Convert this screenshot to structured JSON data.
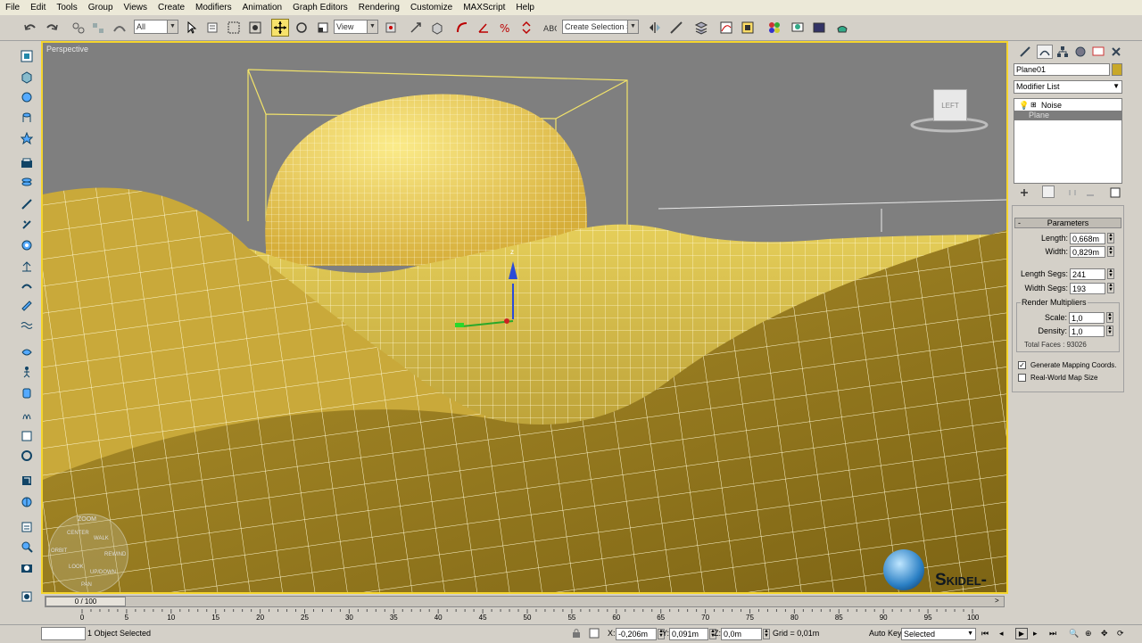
{
  "menu": [
    "File",
    "Edit",
    "Tools",
    "Group",
    "Views",
    "Create",
    "Modifiers",
    "Animation",
    "Graph Editors",
    "Rendering",
    "Customize",
    "MAXScript",
    "Help"
  ],
  "toolbar": {
    "selection_filter": "All",
    "ref_coord": "View",
    "named_selection": "Create Selection Se"
  },
  "viewport": {
    "label": "Perspective",
    "viewcube_label": "LEFT",
    "steering_wheel": [
      "ZOOM",
      "ORBIT",
      "CENTER",
      "WALK",
      "REWIND",
      "LOOK",
      "UP/DOWN",
      "PAN"
    ],
    "watermark": "Skidel-sky.ru",
    "gizmo_axis_z": "z",
    "colors": {
      "background": "#7f7f7f",
      "mesh_fill": "#c9a93a",
      "wire": "#ffffe0",
      "border": "#f5d52d"
    }
  },
  "command_panel": {
    "object_name": "Plane01",
    "object_color": "#c8a828",
    "modifier_list_label": "Modifier List",
    "stack": [
      "Noise",
      "Plane"
    ],
    "rollout_title": "Parameters",
    "params": {
      "length_label": "Length:",
      "length_value": "0,668m",
      "width_label": "Width:",
      "width_value": "0,829m",
      "length_segs_label": "Length Segs:",
      "length_segs_value": "241",
      "width_segs_label": "Width Segs:",
      "width_segs_value": "193",
      "render_multipliers_label": "Render Multipliers",
      "scale_label": "Scale:",
      "scale_value": "1,0",
      "density_label": "Density:",
      "density_value": "1,0",
      "total_faces_label": "Total Faces : 93026",
      "gen_mapping_label": "Generate Mapping Coords.",
      "gen_mapping_checked": true,
      "real_world_label": "Real-World Map Size",
      "real_world_checked": false
    }
  },
  "timeline": {
    "frame_label": "0 / 100",
    "ticks": [
      "0",
      "5",
      "10",
      "15",
      "20",
      "25",
      "30",
      "35",
      "40",
      "45",
      "50",
      "55",
      "60",
      "65",
      "70",
      "75",
      "80",
      "85",
      "90",
      "95",
      "100"
    ]
  },
  "status": {
    "selection_text": "1 Object Selected",
    "x_label": "X:",
    "x_value": "-0,206m",
    "y_label": "Y:",
    "y_value": "0,091m",
    "z_label": "Z:",
    "z_value": "0,0m",
    "grid_text": "Grid = 0,01m",
    "autokey_label": "Auto Key",
    "autokey_value": "Selected"
  }
}
